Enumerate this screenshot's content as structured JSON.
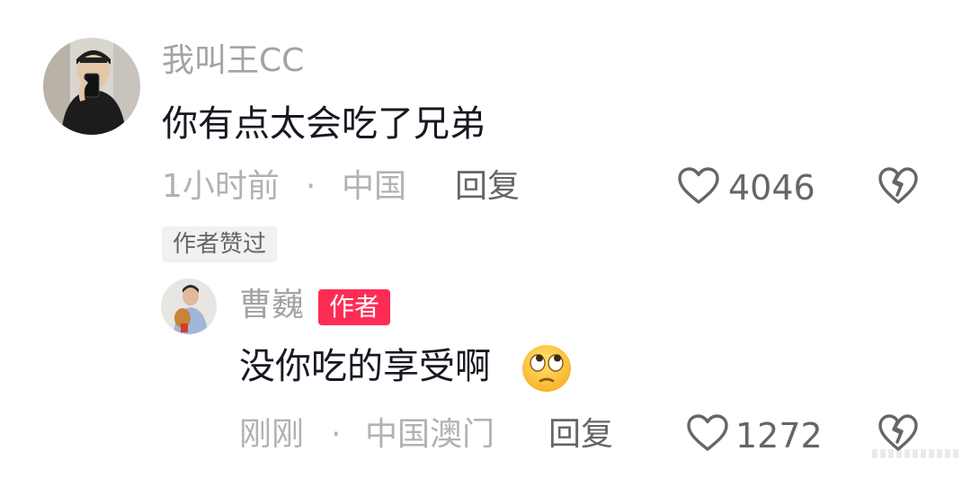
{
  "comment": {
    "username": "我叫王CC",
    "text": "你有点太会吃了兄弟",
    "time": "1小时前",
    "separator": "·",
    "location": "中国",
    "reply_label": "回复",
    "like_count": "4046",
    "liked_by_author_badge": "作者赞过",
    "icons": {
      "like": "heart-outline-icon",
      "dislike": "broken-heart-icon"
    }
  },
  "reply": {
    "username": "曹巍",
    "author_badge": "作者",
    "text": "没你吃的享受啊",
    "emoji": "face-with-rolling-eyes",
    "time": "刚刚",
    "separator": "·",
    "location": "中国澳门",
    "reply_label": "回复",
    "like_count": "1272",
    "icons": {
      "like": "heart-outline-icon",
      "dislike": "broken-heart-icon"
    }
  },
  "colors": {
    "primary_text": "#161823",
    "secondary_text": "#a3a3a3",
    "meta_text": "#b2b2b2",
    "author_badge_bg": "#fe2c55",
    "liked_badge_bg": "#f1f1f2"
  }
}
